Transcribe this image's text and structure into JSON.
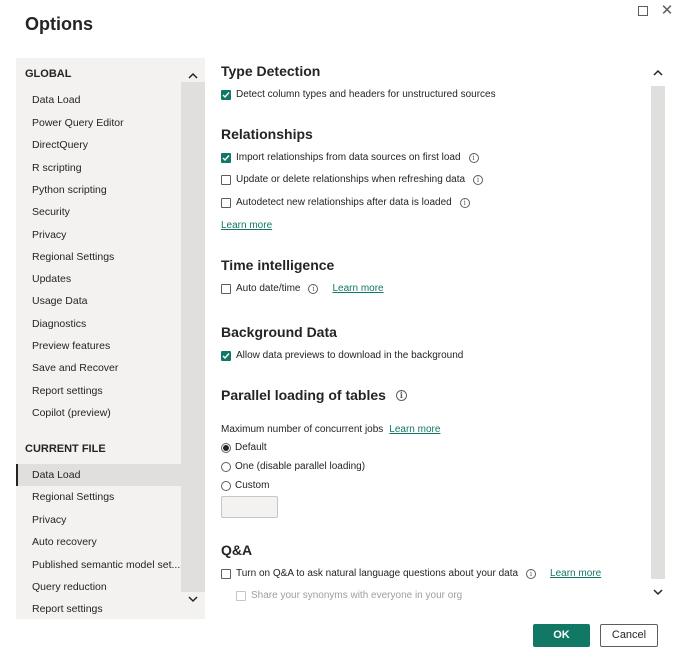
{
  "dialog": {
    "title": "Options"
  },
  "sidebar": {
    "global_header": "GLOBAL",
    "global_items": [
      "Data Load",
      "Power Query Editor",
      "DirectQuery",
      "R scripting",
      "Python scripting",
      "Security",
      "Privacy",
      "Regional Settings",
      "Updates",
      "Usage Data",
      "Diagnostics",
      "Preview features",
      "Save and Recover",
      "Report settings",
      "Copilot (preview)"
    ],
    "current_header": "CURRENT FILE",
    "current_items": [
      "Data Load",
      "Regional Settings",
      "Privacy",
      "Auto recovery",
      "Published semantic model set...",
      "Query reduction",
      "Report settings"
    ],
    "selected": "current.Data Load"
  },
  "sections": {
    "type_detection": {
      "title": "Type Detection",
      "detect_label": "Detect column types and headers for unstructured sources",
      "detect_checked": true
    },
    "relationships": {
      "title": "Relationships",
      "import_label": "Import relationships from data sources on first load",
      "import_checked": true,
      "update_label": "Update or delete relationships when refreshing data",
      "update_checked": false,
      "autodetect_label": "Autodetect new relationships after data is loaded",
      "autodetect_checked": false,
      "learn_more": "Learn more"
    },
    "time_intelligence": {
      "title": "Time intelligence",
      "auto_label": "Auto date/time",
      "auto_checked": false,
      "learn_more": "Learn more"
    },
    "background_data": {
      "title": "Background Data",
      "allow_label": "Allow data previews to download in the background",
      "allow_checked": true
    },
    "parallel": {
      "title": "Parallel loading of tables",
      "max_label": "Maximum number of concurrent jobs",
      "learn_more": "Learn more",
      "options": [
        "Default",
        "One (disable parallel loading)",
        "Custom"
      ],
      "selected": "Default",
      "custom_value": ""
    },
    "qna": {
      "title": "Q&A",
      "turn_on_label": "Turn on Q&A to ask natural language questions about your data",
      "turn_on_checked": false,
      "learn_more": "Learn more",
      "share_label": "Share your synonyms with everyone in your org",
      "share_checked": false
    }
  },
  "footer": {
    "ok_label": "OK",
    "cancel_label": "Cancel"
  },
  "colors": {
    "accent": "#117865",
    "sidebar_bg": "#f3f2f1",
    "scroll_track": "#e1dfdd"
  },
  "icons": {
    "maximize": "maximize-icon",
    "close": "close-icon",
    "info": "info-icon",
    "chevron_up": "chevron-up-icon",
    "chevron_down": "chevron-down-icon"
  }
}
